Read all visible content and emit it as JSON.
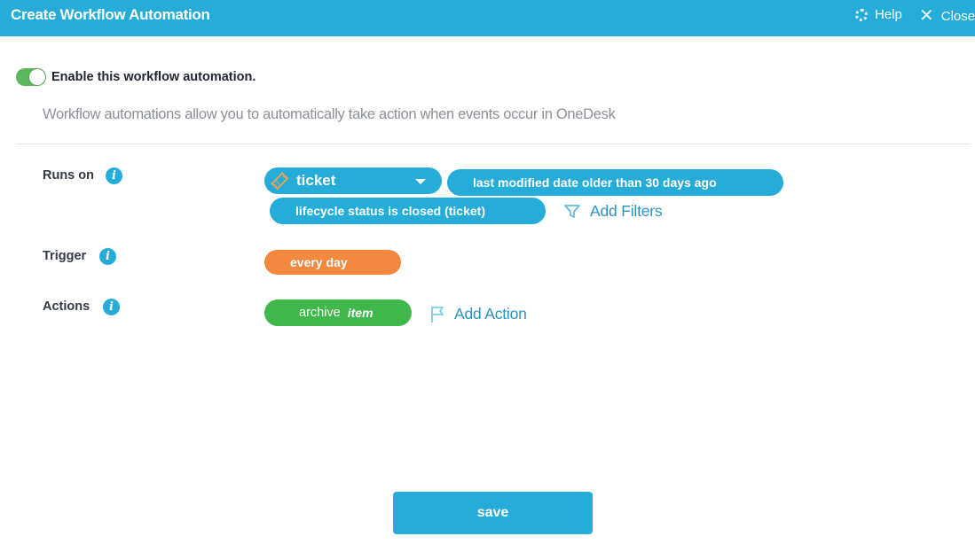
{
  "header": {
    "title": "Create Workflow Automation",
    "help_label": "Help",
    "close_label": "Close"
  },
  "enable": {
    "checked": true,
    "label": "Enable this workflow automation."
  },
  "description": "Workflow automations allow you to automatically take action when events occur in OneDesk",
  "runs_on": {
    "label": "Runs on",
    "entity": "ticket",
    "filters": [
      "last modified date older than 30 days ago",
      "lifecycle status is closed (ticket)"
    ],
    "add_filters_label": "Add Filters"
  },
  "trigger": {
    "label": "Trigger",
    "value": "every day"
  },
  "actions": {
    "label": "Actions",
    "items": [
      {
        "verb": "archive",
        "object": "item"
      }
    ],
    "add_action_label": "Add Action"
  },
  "save_label": "save",
  "colors": {
    "brand": "#26acd9",
    "trigger": "#f5883f",
    "action": "#40b74a",
    "toggle_on": "#5cb85c"
  }
}
